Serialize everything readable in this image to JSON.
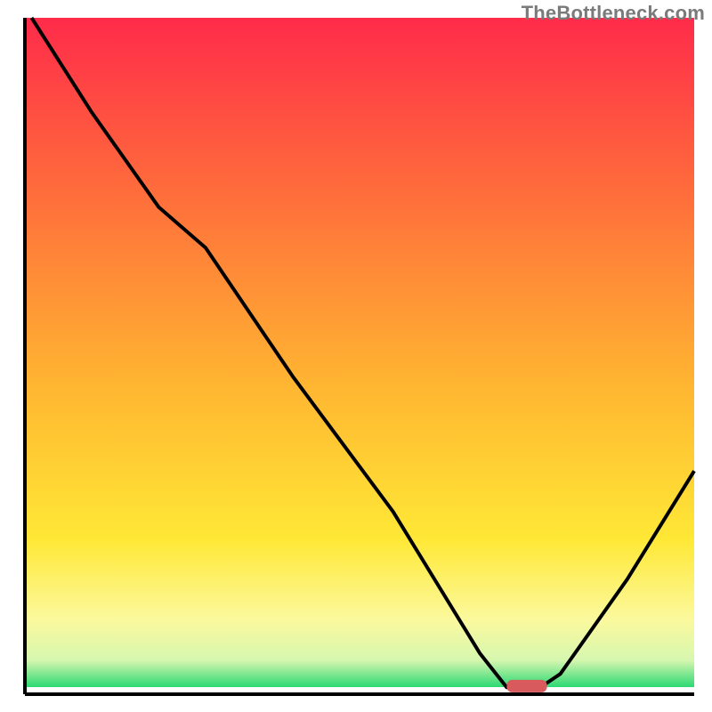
{
  "watermark": "TheBottleneck.com",
  "chart_data": {
    "type": "line",
    "title": "",
    "xlabel": "",
    "ylabel": "",
    "xlim": [
      0,
      100
    ],
    "ylim": [
      0,
      100
    ],
    "grid": false,
    "series": [
      {
        "name": "bottleneck-curve",
        "color": "#000000",
        "x": [
          1,
          10,
          20,
          27,
          40,
          55,
          68,
          72,
          77,
          80,
          90,
          100
        ],
        "y": [
          100,
          86,
          72,
          66,
          47,
          27,
          6,
          1,
          1,
          3,
          17,
          33
        ]
      }
    ],
    "marker": {
      "name": "optimal-range",
      "color": "#d85a5d",
      "x_start": 72,
      "x_end": 78,
      "y": 1.2
    },
    "background_gradient": {
      "stops": [
        {
          "offset": 0,
          "color": "#ff2b4a"
        },
        {
          "offset": 25,
          "color": "#ff6a3c"
        },
        {
          "offset": 55,
          "color": "#ffb631"
        },
        {
          "offset": 78,
          "color": "#ffe836"
        },
        {
          "offset": 90,
          "color": "#fbf99e"
        },
        {
          "offset": 96,
          "color": "#d6f7af"
        },
        {
          "offset": 100,
          "color": "#2dd973"
        }
      ]
    },
    "axes": {
      "left": {
        "x": 3.5,
        "y0": 3.5,
        "y1": 97.5
      },
      "bottom": {
        "y": 97.5,
        "x0": 3.5,
        "x1": 97.5
      }
    }
  }
}
